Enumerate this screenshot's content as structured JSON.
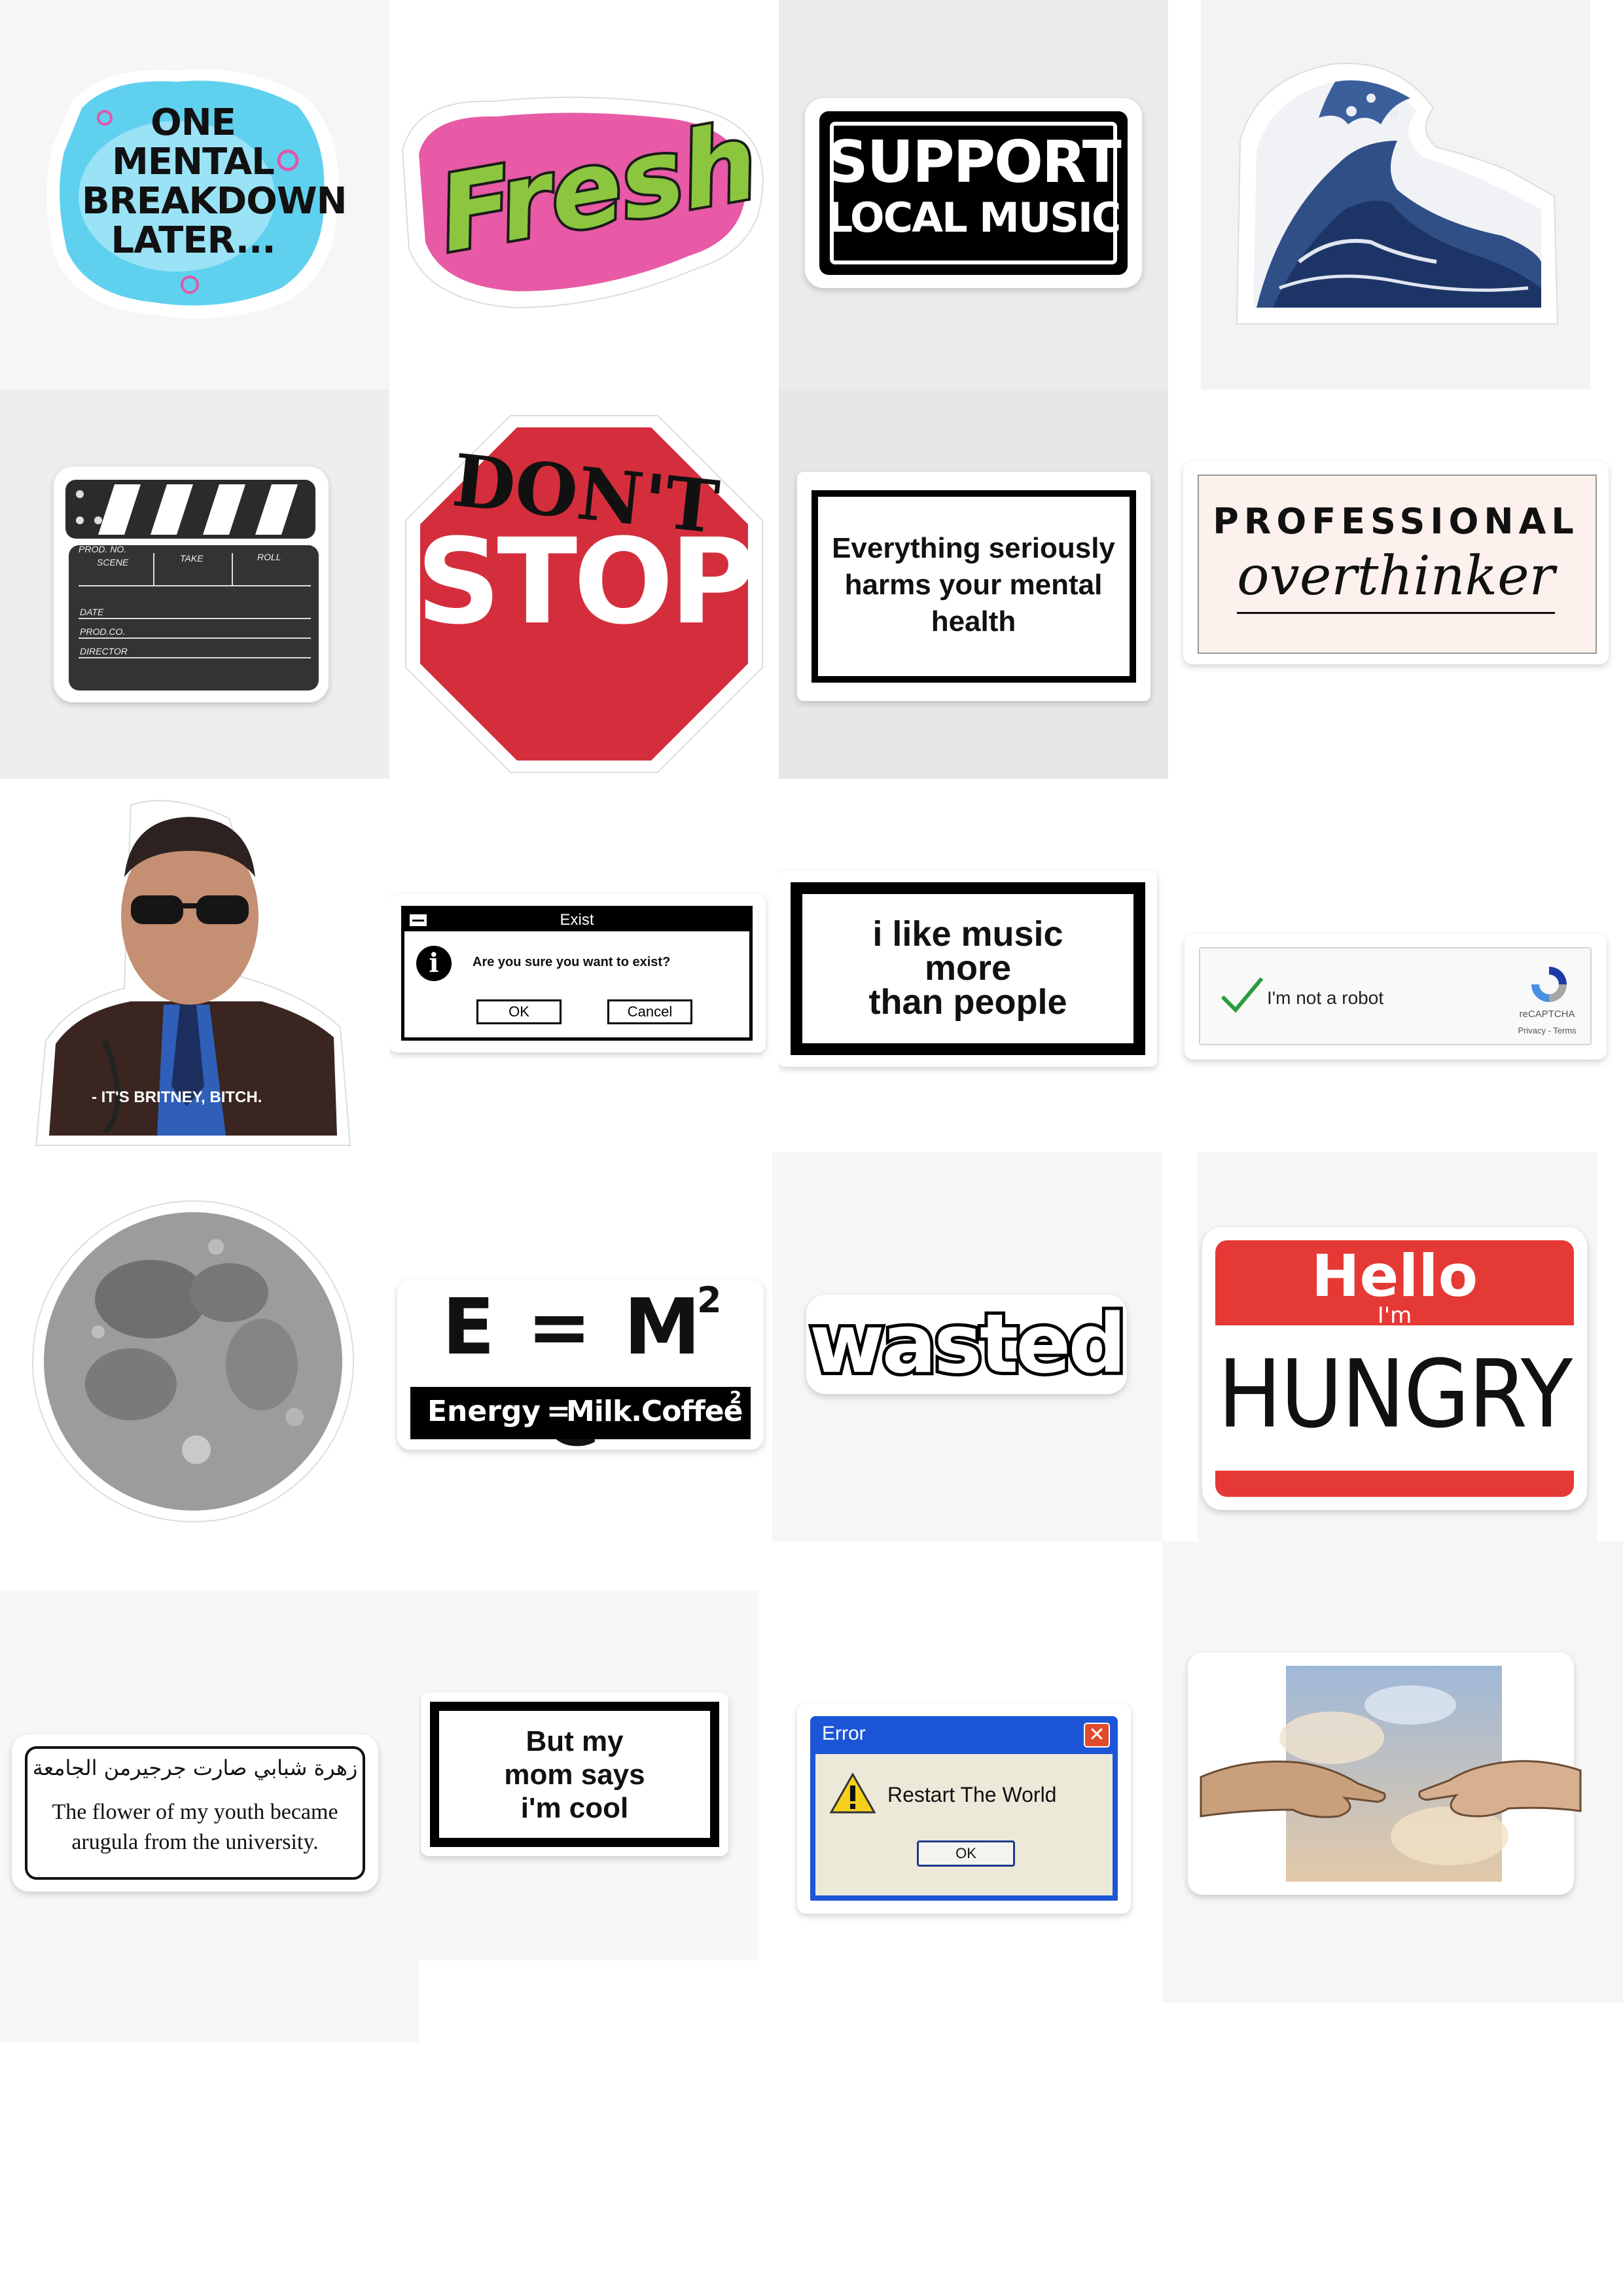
{
  "stickers": {
    "mental_breakdown": {
      "text": "ONE MENTAL BREAKDOWN LATER..."
    },
    "fresh": {
      "text": "Fresh"
    },
    "support_local_music": {
      "line1": "SUPPORT",
      "line2": "LOCAL MUSIC"
    },
    "great_wave": {
      "icon": "great-wave-icon"
    },
    "clapperboard": {
      "prod_no": "PROD. NO.",
      "scene": "SCENE",
      "take": "TAKE",
      "roll": "ROLL",
      "date": "DATE",
      "prod_co": "PROD.CO.",
      "director": "DIRECTOR"
    },
    "dont_stop": {
      "top": "DON'T",
      "bottom": "STOP"
    },
    "mental_health": {
      "text": "Everything seriously harms your mental health"
    },
    "overthinker": {
      "line1": "PROFESSIONAL",
      "line2": "overthinker"
    },
    "britney": {
      "caption": "- IT'S BRITNEY, BITCH."
    },
    "exist_dialog": {
      "title": "Exist",
      "message": "Are you sure you want to exist?",
      "ok": "OK",
      "cancel": "Cancel"
    },
    "music_people": {
      "line1": "i like music",
      "line2": "more",
      "line3": "than people"
    },
    "recaptcha": {
      "label": "I'm not a robot",
      "brand": "reCAPTCHA",
      "links": "Privacy - Terms"
    },
    "moon": {
      "icon": "moon-icon"
    },
    "emc2": {
      "formula": "E = M C",
      "exp": "2",
      "sub_a": "Energy",
      "sub_eq": "=",
      "sub_b": "Milk.Coffee",
      "sub_exp": "2"
    },
    "wasted": {
      "text": "wasted"
    },
    "hello_hungry": {
      "hello": "Hello",
      "im": "I'm",
      "name": "HUNGRY"
    },
    "arabic": {
      "arabic": "زهرة شبابي صارت جرجيرمن الجامعة",
      "line1": "The flower of my youth became",
      "line2": "arugula from the university."
    },
    "mom_says": {
      "line1": "But my",
      "line2": "mom says",
      "line3": "i'm cool"
    },
    "error_dialog": {
      "title": "Error",
      "message": "Restart The World",
      "ok": "OK"
    },
    "creation_of_adam": {
      "icon": "creation-of-adam-icon"
    }
  },
  "colors": {
    "stop_red": "#d42e3c",
    "fresh_green": "#8cc63f",
    "fresh_pink": "#e85aa5",
    "hello_red": "#e53935",
    "xp_blue": "#1c55d6",
    "overthinker_bg": "#fcf1ec"
  }
}
